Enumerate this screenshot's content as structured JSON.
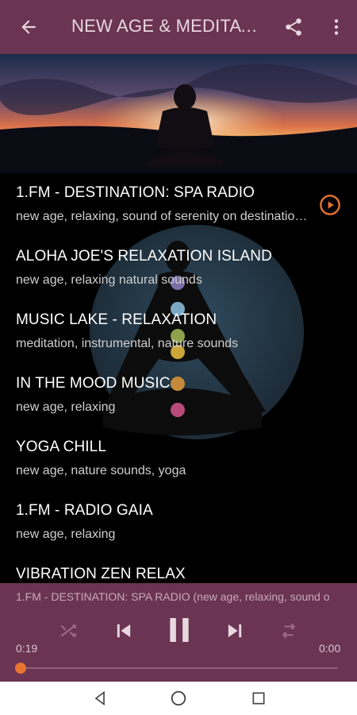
{
  "appbar": {
    "title": "NEW AGE & MEDITATION",
    "back_icon": "arrow-left-icon",
    "share_icon": "share-icon",
    "more_icon": "more-vert-icon"
  },
  "stations": [
    {
      "name": "1.FM - DESTINATION: SPA RADIO",
      "tags": "new age, relaxing, sound of serenity on destination spa",
      "playing": true
    },
    {
      "name": "ALOHA JOE'S RELAXATION ISLAND",
      "tags": "new age, relaxing natural sounds"
    },
    {
      "name": "MUSIC LAKE - RELAXATION",
      "tags": "meditation, instrumental, nature sounds"
    },
    {
      "name": "IN THE MOOD MUSIC",
      "tags": "new age, relaxing"
    },
    {
      "name": "YOGA CHILL",
      "tags": "new age, nature sounds, yoga"
    },
    {
      "name": "1.FM - RADIO GAIA",
      "tags": "new age, relaxing"
    },
    {
      "name": "VIBRATION ZEN RELAX",
      "tags": ""
    }
  ],
  "player": {
    "now_playing": "1.FM - DESTINATION: SPA RADIO (new age, relaxing, sound o",
    "elapsed": "0:19",
    "duration": "0:00",
    "progress": 0.0
  },
  "colors": {
    "primary": "#6b3452",
    "accent": "#e8742f"
  }
}
